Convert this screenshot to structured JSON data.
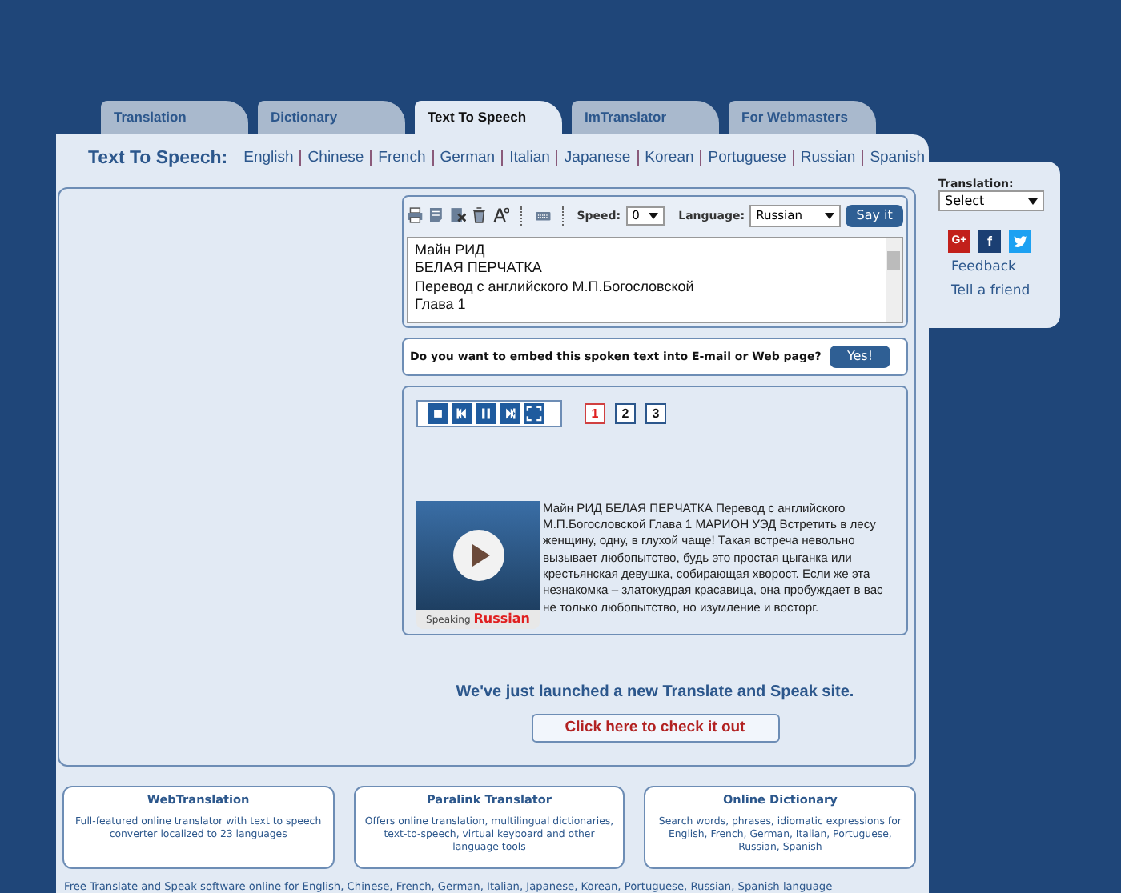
{
  "tabs": [
    {
      "label": "Translation",
      "selected": false
    },
    {
      "label": "Dictionary",
      "selected": false
    },
    {
      "label": "Text To Speech",
      "selected": true
    },
    {
      "label": "ImTranslator",
      "selected": false
    },
    {
      "label": "For Webmasters",
      "selected": false
    }
  ],
  "heading": "Text To Speech:",
  "languages": [
    "English",
    "Chinese",
    "French",
    "German",
    "Italian",
    "Japanese",
    "Korean",
    "Portuguese",
    "Russian",
    "Spanish"
  ],
  "toolbar": {
    "speed_label": "Speed:",
    "speed": "0",
    "language_label": "Language:",
    "language": "Russian",
    "say_button": "Say it"
  },
  "text_input": "Майн РИД\nБЕЛАЯ ПЕРЧАТКА\nПеревод с английского М.П.Богословской\nГлава 1",
  "embed": {
    "question": "Do you want to embed this spoken text into E-mail or Web page?",
    "button": "Yes!"
  },
  "pages": [
    {
      "label": "1",
      "selected": true
    },
    {
      "label": "2",
      "selected": false
    },
    {
      "label": "3",
      "selected": false
    }
  ],
  "video": {
    "caption_prefix": "Speaking",
    "caption_language": "Russian"
  },
  "spoken_text": "Майн РИД БЕЛАЯ ПЕРЧАТКА Перевод с английского М.П.Богословской Глава 1 МАРИОН УЭД Встретить в лесу женщину, одну, в глухой чаще! Такая встреча невольно вызывает любопытство, будь это простая цыганка или крестьянская девушка, собирающая хворост. Если же эта незнакомка – златокудрая красавица, она пробуждает в вас не только любопытство, но изумление и восторг.",
  "promo": {
    "text": "We've just launched a new Translate and Speak site.",
    "button": "Click here to check it out"
  },
  "cards": [
    {
      "title": "WebTranslation",
      "text": "Full-featured online translator with text to speech converter localized to 23 languages"
    },
    {
      "title": "Paralink Translator",
      "text": "Offers online translation, multilingual dictionaries, text-to-speech, virtual keyboard and other language tools"
    },
    {
      "title": "Online Dictionary",
      "text": "Search words, phrases, idiomatic expressions for English, French, German, Italian, Portuguese, Russian, Spanish"
    }
  ],
  "footer": "Free Translate and Speak software online for English, Chinese, French, German, Italian, Japanese, Korean, Portuguese, Russian, Spanish language",
  "sidebar": {
    "label": "Translation:",
    "select": "Select",
    "social": [
      {
        "kind": "gplus",
        "glyph": "G+"
      },
      {
        "kind": "facebook",
        "glyph": "f"
      },
      {
        "kind": "twitter"
      }
    ],
    "links": [
      "Feedback",
      "Tell a friend"
    ]
  }
}
